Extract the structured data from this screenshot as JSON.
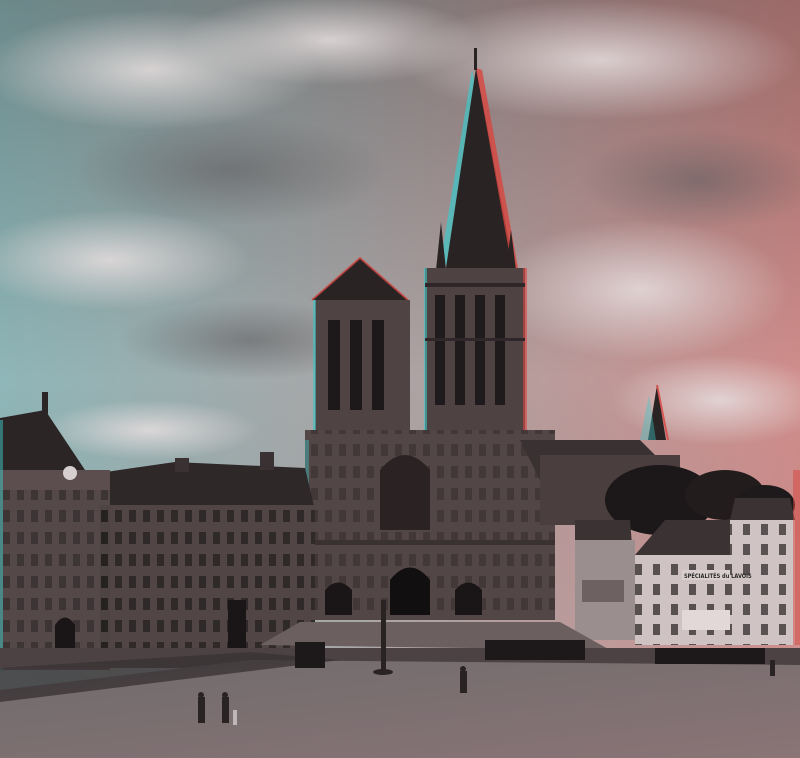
{
  "photo": {
    "kind": "stereoscopic anaglyph photograph",
    "subject": "cathedral-square"
  },
  "signage": {
    "shopfront_sign": "SPÉCIALITÉS du LAVOIS"
  },
  "colors": {
    "sky_left": "#8fb6b8",
    "sky_mid": "#a8a7a8",
    "sky_right": "#c98a8a",
    "stone": "#5a4d4d",
    "stone_dark": "#2e2828",
    "ground": "#7a6d6e",
    "cyan_fringe": "#3fc7c7",
    "red_fringe": "#d8453f"
  }
}
